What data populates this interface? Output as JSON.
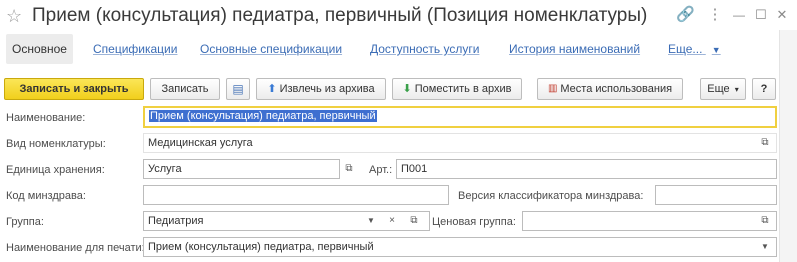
{
  "window": {
    "title": "Прием (консультация) педиатра, первичный (Позиция номенклатуры)",
    "star_icon": "star-icon",
    "link_icon": "link-icon",
    "menu_icon": "more-vertical-icon",
    "minimize_icon": "minimize-icon",
    "maximize_icon": "maximize-icon",
    "close_icon": "close-icon",
    "star": "☆",
    "link": "🔗",
    "menu": "⋮",
    "minimize": "—",
    "maximize": "☐",
    "close": "✕"
  },
  "tabs": [
    {
      "label": "Основное",
      "active": true
    },
    {
      "label": "Спецификации"
    },
    {
      "label": "Основные спецификации"
    },
    {
      "label": "Доступность услуги"
    },
    {
      "label": "История наименований"
    },
    {
      "label": "Еще..."
    }
  ],
  "toolbar": {
    "save_close": "Записать и закрыть",
    "save": "Записать",
    "extract_archive": "Извлечь из архива",
    "put_archive": "Поместить в архив",
    "usage_places": "Места использования",
    "more": "Еще",
    "help": "?"
  },
  "form": {
    "name_label": "Наименование:",
    "name_value": "Прием (консультация) педиатра, первичный",
    "type_label": "Вид номенклатуры:",
    "type_value": "Медицинская услуга",
    "unit_label": "Единица хранения:",
    "unit_value": "Услуга",
    "art_label": "Арт.:",
    "art_value": "П001",
    "minzdrav_label": "Код минздрава:",
    "minzdrav_value": "",
    "classifier_label": "Версия классификатора минздрава:",
    "classifier_value": "",
    "group_label": "Группа:",
    "group_value": "Педиатрия",
    "price_group_label": "Ценовая группа:",
    "price_group_value": "",
    "print_name_label": "Наименование для печати:",
    "print_name_value": "Прием (консультация) педиатра, первичный"
  },
  "colors": {
    "primary_button": "#f1cf1c",
    "link": "#3b6cb5",
    "focus_border": "#f0d040",
    "selection": "#3e6fd0"
  }
}
